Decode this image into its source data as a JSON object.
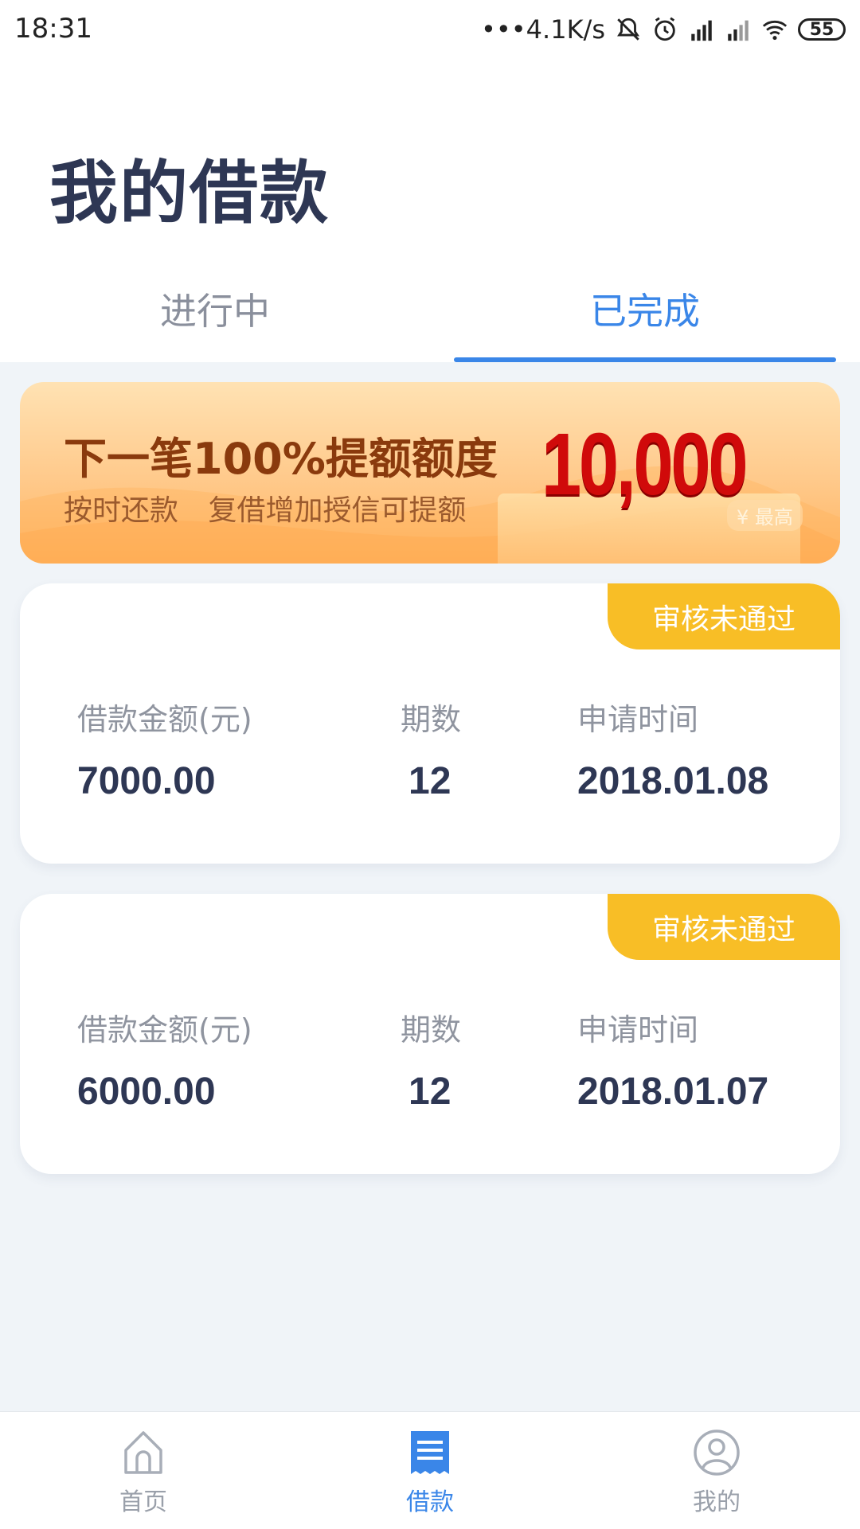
{
  "status_bar": {
    "time": "18:31",
    "network_speed": "•••4.1K/s",
    "battery": "55",
    "icons": [
      "mute-icon",
      "alarm-icon",
      "hd-signal-icon",
      "signal-icon",
      "wifi-icon",
      "battery-icon"
    ]
  },
  "page": {
    "title": "我的借款"
  },
  "tabs": [
    {
      "label": "进行中",
      "active": false
    },
    {
      "label": "已完成",
      "active": true
    }
  ],
  "banner": {
    "headline": "下一笔100%提额额度",
    "subline_a": "按时还款",
    "subline_b": "复借增加授信可提额",
    "amount": "10,000",
    "note": "¥ 最高"
  },
  "loans": [
    {
      "status": "审核未通过",
      "amount_label": "借款金额(元)",
      "amount": "7000.00",
      "periods_label": "期数",
      "periods": "12",
      "time_label": "申请时间",
      "time": "2018.01.08"
    },
    {
      "status": "审核未通过",
      "amount_label": "借款金额(元)",
      "amount": "6000.00",
      "periods_label": "期数",
      "periods": "12",
      "time_label": "申请时间",
      "time": "2018.01.07"
    }
  ],
  "bottom_nav": [
    {
      "label": "首页",
      "icon": "home-icon",
      "active": false
    },
    {
      "label": "借款",
      "icon": "loan-document-icon",
      "active": true
    },
    {
      "label": "我的",
      "icon": "profile-icon",
      "active": false
    }
  ],
  "colors": {
    "accent": "#3a86e8",
    "badge": "#f8be26",
    "title": "#2e3754",
    "banner_amount": "#d00a0a",
    "background": "#f0f4f8"
  }
}
